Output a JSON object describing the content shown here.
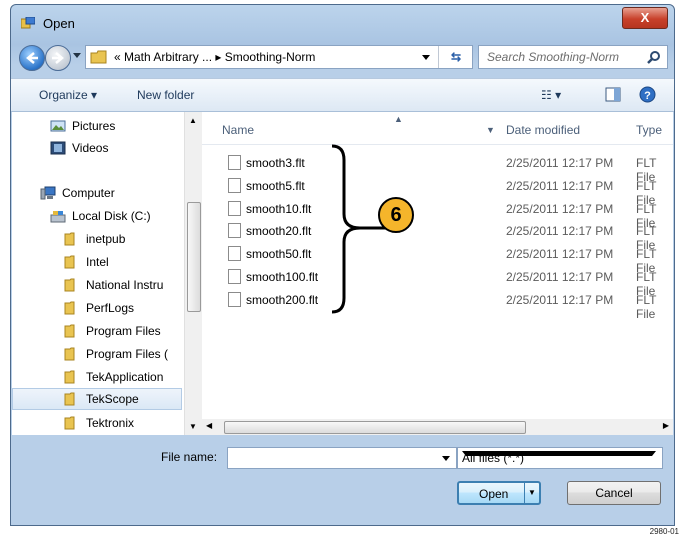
{
  "window": {
    "title": "Open",
    "close_label": "X"
  },
  "nav": {
    "crumbs": "« Math Arbitrary ...  ▸  Smoothing-Norm",
    "search_placeholder": "Search Smoothing-Norm"
  },
  "toolbar": {
    "organize": "Organize ▾",
    "new_folder": "New folder",
    "views": "☷ ▾"
  },
  "sidebar": {
    "items": [
      "Pictures",
      "Videos",
      "Computer",
      "Local Disk (C:)",
      "inetpub",
      "Intel",
      "National Instru",
      "PerfLogs",
      "Program Files",
      "Program Files (",
      "TekApplication",
      "TekScope",
      "Tektronix"
    ],
    "selected": "TekScope"
  },
  "columns": {
    "name": "Name",
    "date": "Date modified",
    "type": "Type"
  },
  "files": [
    {
      "name": "smooth3.flt",
      "date": "2/25/2011 12:17 PM",
      "type": "FLT File"
    },
    {
      "name": "smooth5.flt",
      "date": "2/25/2011 12:17 PM",
      "type": "FLT File"
    },
    {
      "name": "smooth10.flt",
      "date": "2/25/2011 12:17 PM",
      "type": "FLT File"
    },
    {
      "name": "smooth20.flt",
      "date": "2/25/2011 12:17 PM",
      "type": "FLT File"
    },
    {
      "name": "smooth50.flt",
      "date": "2/25/2011 12:17 PM",
      "type": "FLT File"
    },
    {
      "name": "smooth100.flt",
      "date": "2/25/2011 12:17 PM",
      "type": "FLT File"
    },
    {
      "name": "smooth200.flt",
      "date": "2/25/2011 12:17 PM",
      "type": "FLT File"
    }
  ],
  "bottom": {
    "file_name_label": "File name:",
    "file_name_value": "",
    "filter": "All files (*.*)",
    "open": "Open",
    "cancel": "Cancel"
  },
  "annotation": {
    "number": "6"
  },
  "figure_id": "2980-01"
}
